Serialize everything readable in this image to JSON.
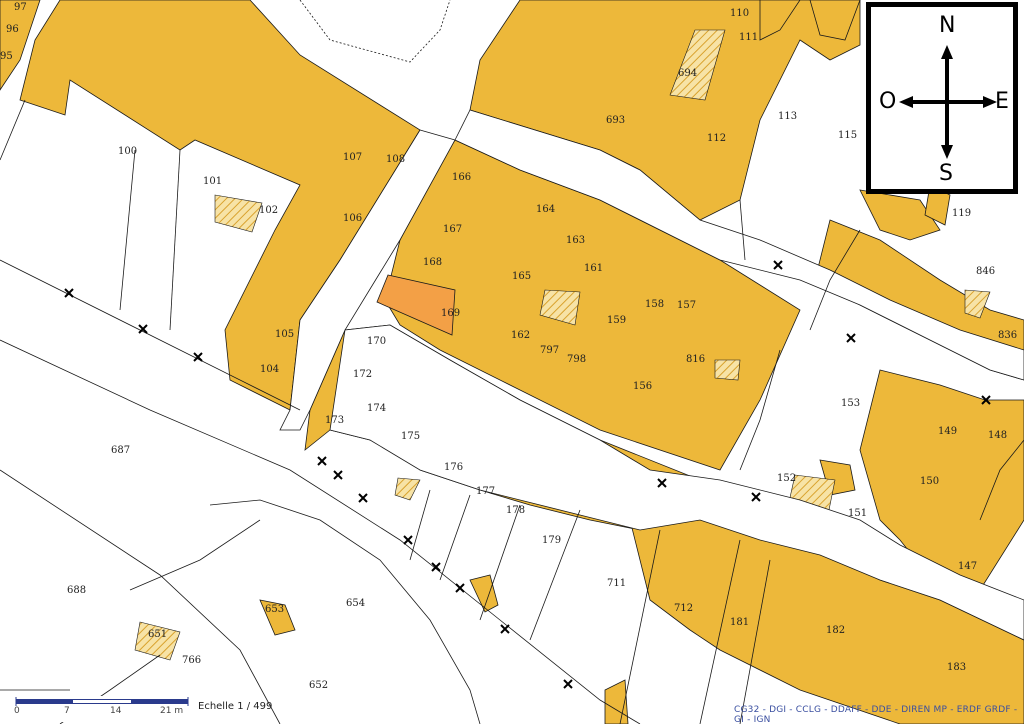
{
  "colors": {
    "built": "#EDB83A",
    "selected": "#F3A046",
    "parcel_line": "#1a1a1a",
    "background": "#FFFFFF",
    "hatch": "#D9A22E",
    "credits_text": "#3A4FA0"
  },
  "compass": {
    "north": "N",
    "south": "S",
    "east": "E",
    "west": "O"
  },
  "scale": {
    "ticks": [
      "0",
      "7",
      "14",
      "21 m"
    ],
    "label": "Echelle 1 / 499"
  },
  "credits": "CG32 - DGI - CCLG - DDAFF - DDE - DIREN MP - ERDF GRDF - GI - IGN",
  "selected_parcel": "169",
  "parcels": [
    "97",
    "96",
    "95",
    "100",
    "101",
    "102",
    "105",
    "104",
    "106",
    "107",
    "108",
    "166",
    "167",
    "168",
    "169",
    "165",
    "164",
    "163",
    "161",
    "162",
    "797",
    "798",
    "159",
    "158",
    "157",
    "816",
    "156",
    "170",
    "172",
    "173",
    "174",
    "175",
    "176",
    "177",
    "178",
    "179",
    "153",
    "149",
    "148",
    "150",
    "152",
    "151",
    "147",
    "694",
    "693",
    "110",
    "111",
    "112",
    "113",
    "115",
    "119",
    "846",
    "836",
    "687",
    "688",
    "651",
    "653",
    "654",
    "652",
    "766",
    "711",
    "712",
    "181",
    "182",
    "183"
  ]
}
